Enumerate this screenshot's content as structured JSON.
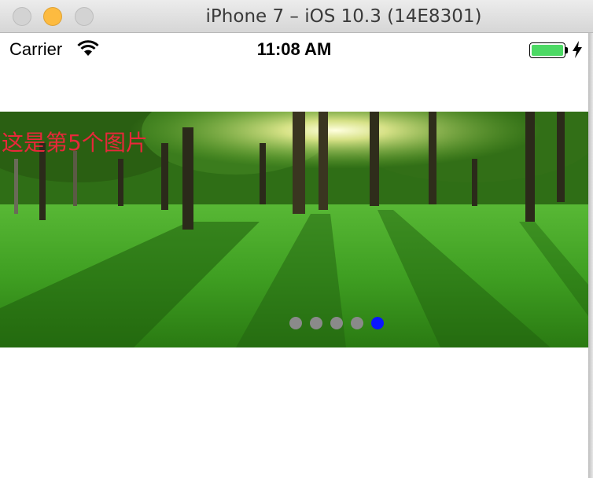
{
  "window": {
    "title": "iPhone 7 – iOS 10.3 (14E8301)"
  },
  "status_bar": {
    "carrier": "Carrier",
    "time": "11:08 AM",
    "battery_level": 1.0
  },
  "carousel": {
    "caption": "这是第5个图片",
    "caption_color": "#e8283a",
    "page_count": 5,
    "current_page": 5,
    "dot_color": "#8a8a8a",
    "active_dot_color": "#0a16ff",
    "image": "forest-park-sunlight"
  }
}
